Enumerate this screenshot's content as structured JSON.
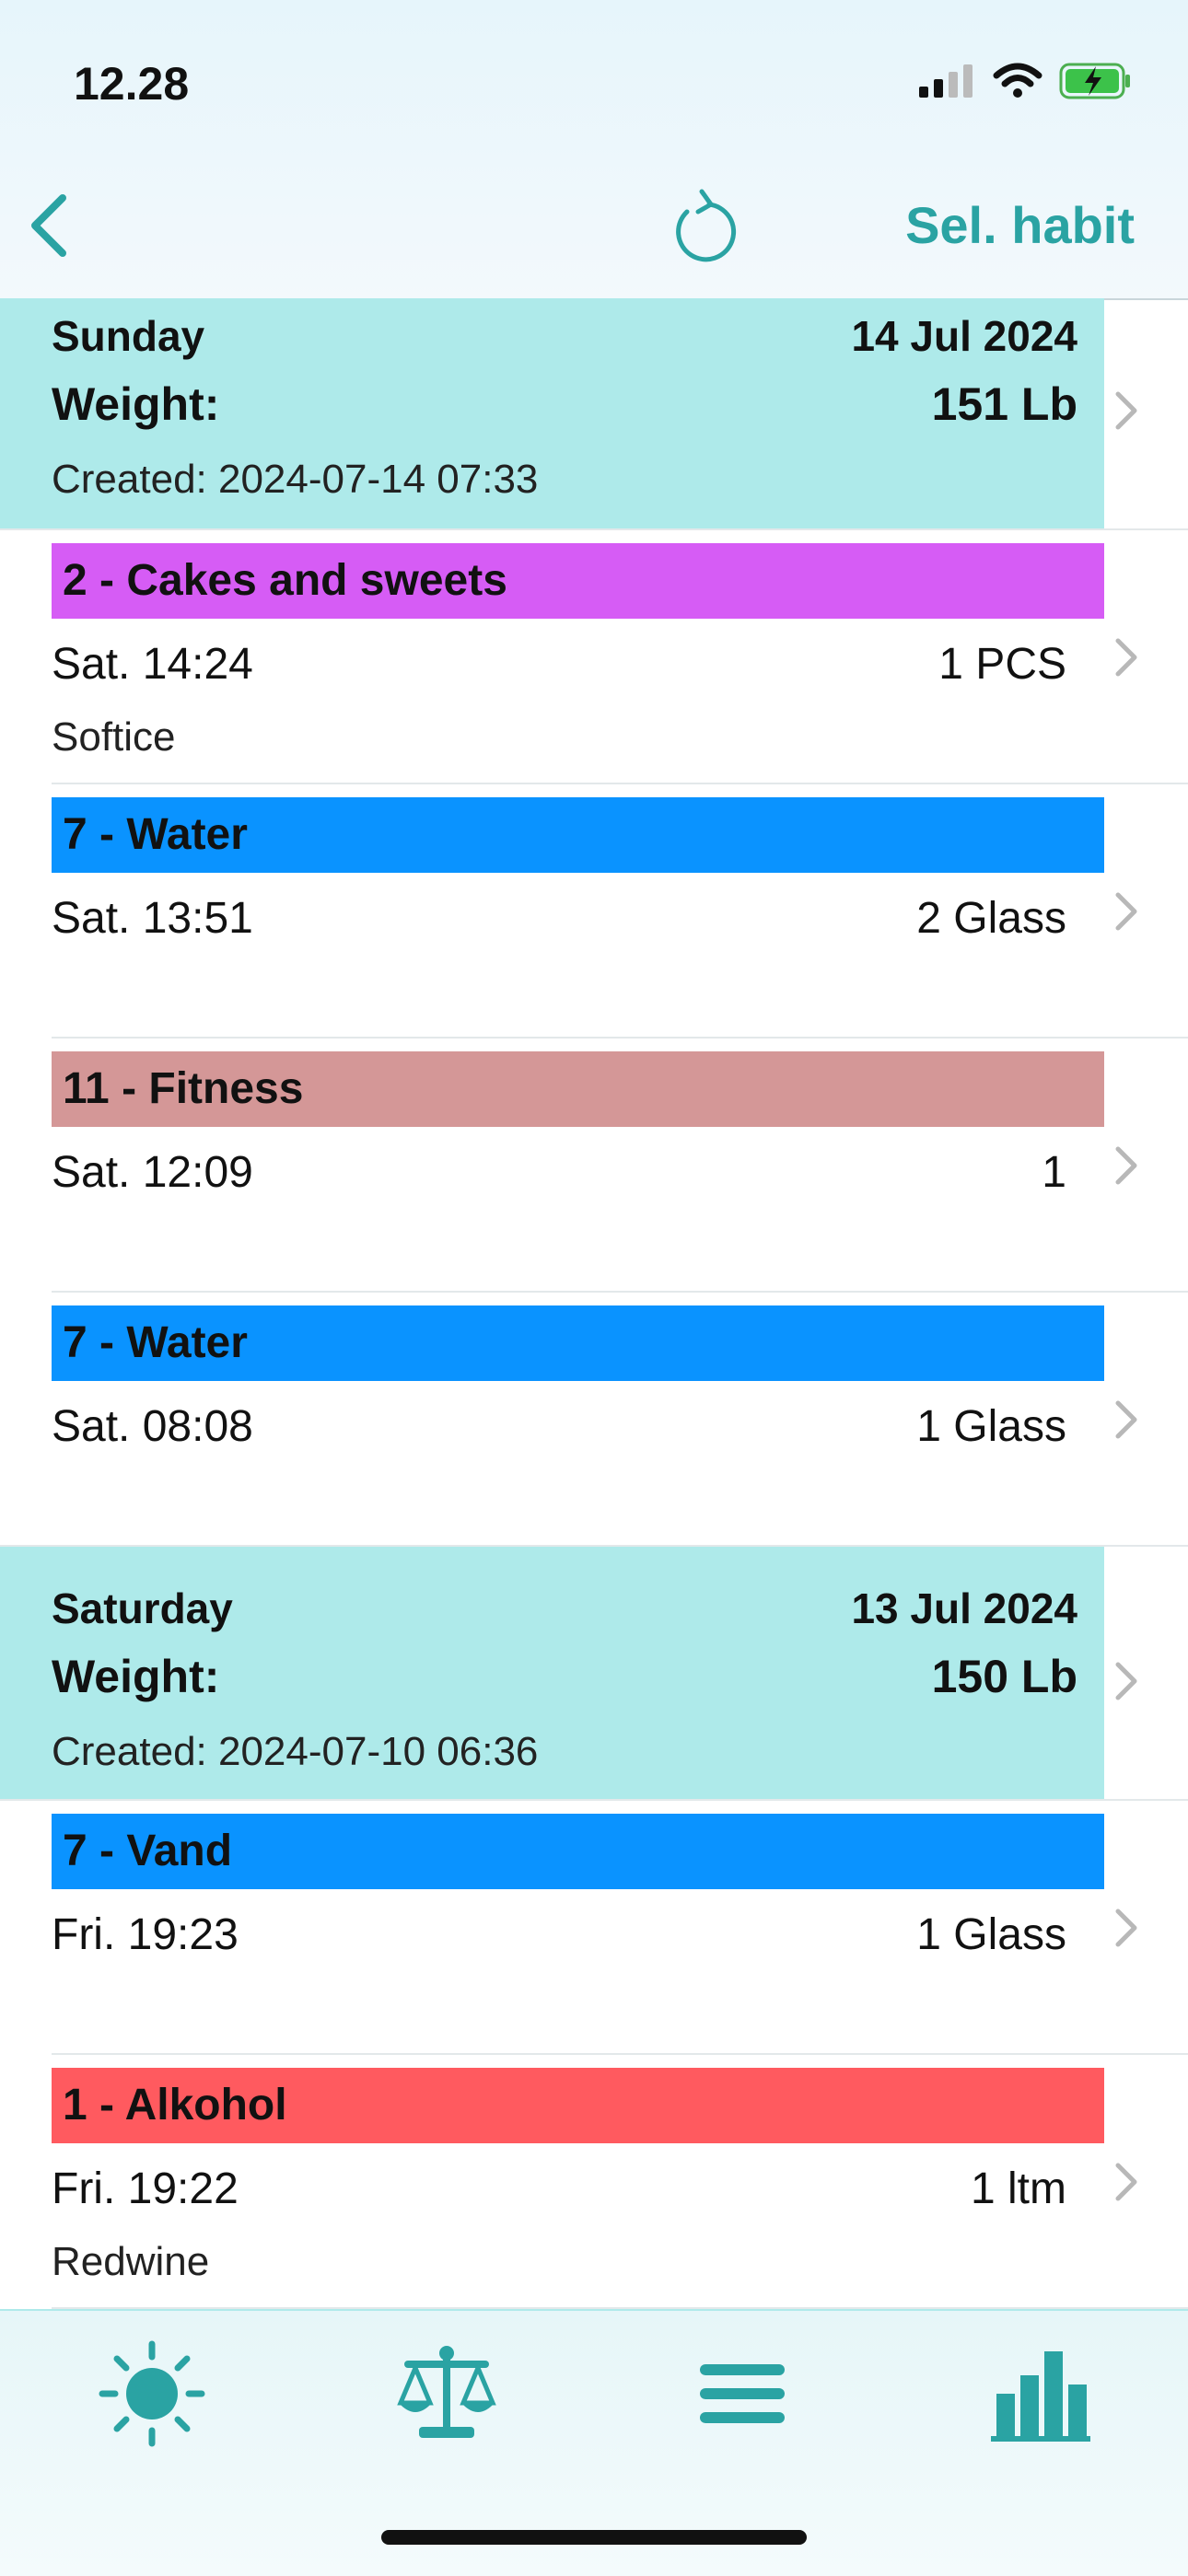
{
  "status_bar": {
    "time": "12.28"
  },
  "nav": {
    "select_label": "Sel. habit"
  },
  "colors": {
    "accent": "#2aa3a3",
    "day_header": "#aeeaea"
  },
  "days": [
    {
      "name": "Sunday",
      "date": "14 Jul 2024",
      "weight_label": "Weight:",
      "weight_value": "151 Lb",
      "created": "Created: 2024-07-14 07:33"
    },
    {
      "name": "Saturday",
      "date": "13 Jul 2024",
      "weight_label": "Weight:",
      "weight_value": "150 Lb",
      "created": "Created: 2024-07-10 06:36"
    }
  ],
  "entries": [
    {
      "habit": "2 - Cakes and sweets",
      "color": "#d65cf5",
      "time": "Sat. 14:24",
      "qty": "1 PCS",
      "note": "Softice"
    },
    {
      "habit": "7 - Water",
      "color": "#0a93ff",
      "time": "Sat. 13:51",
      "qty": "2 Glass",
      "note": ""
    },
    {
      "habit": "11 - Fitness",
      "color": "#d49797",
      "time": "Sat. 12:09",
      "qty": "1",
      "note": ""
    },
    {
      "habit": "7 - Water",
      "color": "#0a93ff",
      "time": "Sat. 08:08",
      "qty": "1 Glass",
      "note": ""
    },
    {
      "habit": "7 - Vand",
      "color": "#0a93ff",
      "time": "Fri. 19:23",
      "qty": "1 Glass",
      "note": ""
    },
    {
      "habit": "1 - Alkohol",
      "color": "#ff5a5f",
      "time": "Fri. 19:22",
      "qty": "1 ltm",
      "note": "Redwine"
    }
  ],
  "tabs": [
    {
      "icon": "sun-icon"
    },
    {
      "icon": "scale-icon"
    },
    {
      "icon": "menu-icon"
    },
    {
      "icon": "bar-chart-icon"
    }
  ]
}
